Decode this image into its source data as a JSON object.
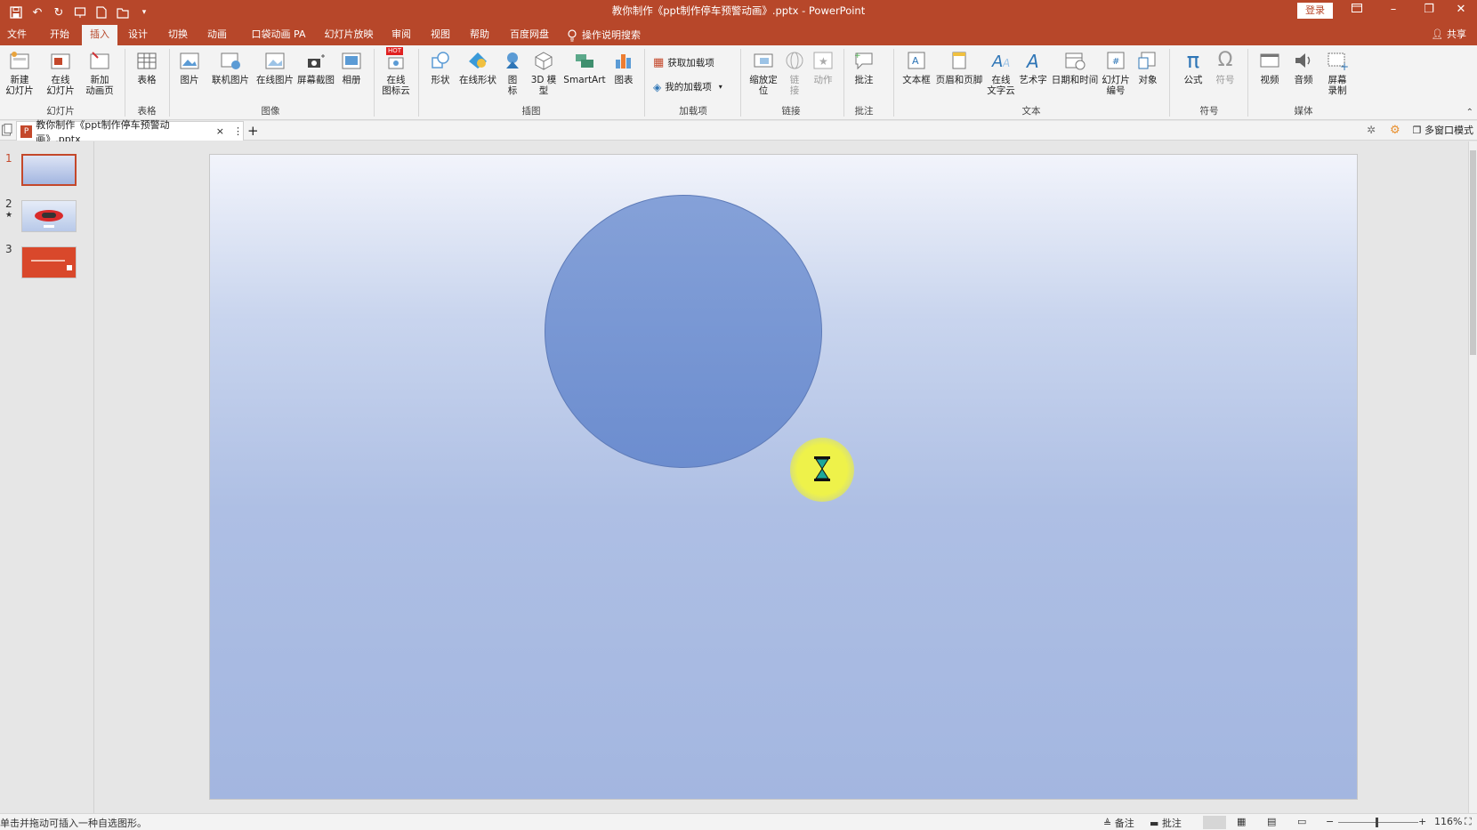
{
  "title": {
    "document": "教你制作《ppt制作停车预警动画》.pptx",
    "separator": "-",
    "app": "PowerPoint",
    "login": "登录"
  },
  "tabs": [
    "文件",
    "开始",
    "插入",
    "设计",
    "切换",
    "动画",
    "口袋动画 PA",
    "幻灯片放映",
    "审阅",
    "视图",
    "帮助",
    "百度网盘",
    "操作说明搜索"
  ],
  "active_tab": "插入",
  "share": "共享",
  "ribbon": {
    "buttons": {
      "new_slide": "新建\n幻灯片",
      "online_slide": "在线\n幻灯片",
      "new_anim": "新加\n动画页",
      "table": "表格",
      "picture": "图片",
      "online_picture": "联机图片",
      "online_picture2": "在线图片",
      "screenshot": "屏幕截图",
      "album": "相册",
      "icon_cloud": "在线\n图标云",
      "shapes": "形状",
      "online_shapes": "在线形状",
      "icons": "图\n标",
      "model3d": "3D 模\n型",
      "smartart": "SmartArt",
      "chart": "图表",
      "get_addins": "获取加载项",
      "my_addins": "我的加载项",
      "zoom": "缩放定\n位",
      "link": "链\n接",
      "action": "动作",
      "comment": "批注",
      "textbox": "文本框",
      "header_footer": "页眉和页脚",
      "online_wordcloud": "在线\n文字云",
      "wordart": "艺术字",
      "datetime": "日期和时间",
      "slide_number": "幻灯片\n编号",
      "object": "对象",
      "equation": "公式",
      "symbol": "符号",
      "video": "视频",
      "audio": "音频",
      "screen_record": "屏幕\n录制",
      "hot_badge": "HOT"
    },
    "groups": {
      "slides": "幻灯片",
      "tables": "表格",
      "images": "图像",
      "illustrations": "插图",
      "addins": "加载项",
      "links": "链接",
      "comments": "批注",
      "text": "文本",
      "symbols": "符号",
      "media": "媒体"
    }
  },
  "doc_tab": {
    "name": "教你制作《ppt制作停车预警动画》.pptx",
    "close": "×",
    "more": "⋮",
    "add": "+"
  },
  "multi_window": "多窗口模式",
  "thumbnails": [
    {
      "num": "1",
      "star": ""
    },
    {
      "num": "2",
      "star": "★"
    },
    {
      "num": "3",
      "star": ""
    }
  ],
  "status": {
    "hint": "单击并拖动可插入一种自选图形。",
    "notes": "备注",
    "comments": "批注",
    "zoom_minus": "−",
    "zoom_plus": "+",
    "zoom": "116%"
  },
  "colors": {
    "accent": "#b7472a",
    "slide_top": "#f2f4fb",
    "slide_bottom": "#a3b6e0",
    "circle": "#7594d3",
    "cursor_highlight": "#eef24a"
  }
}
